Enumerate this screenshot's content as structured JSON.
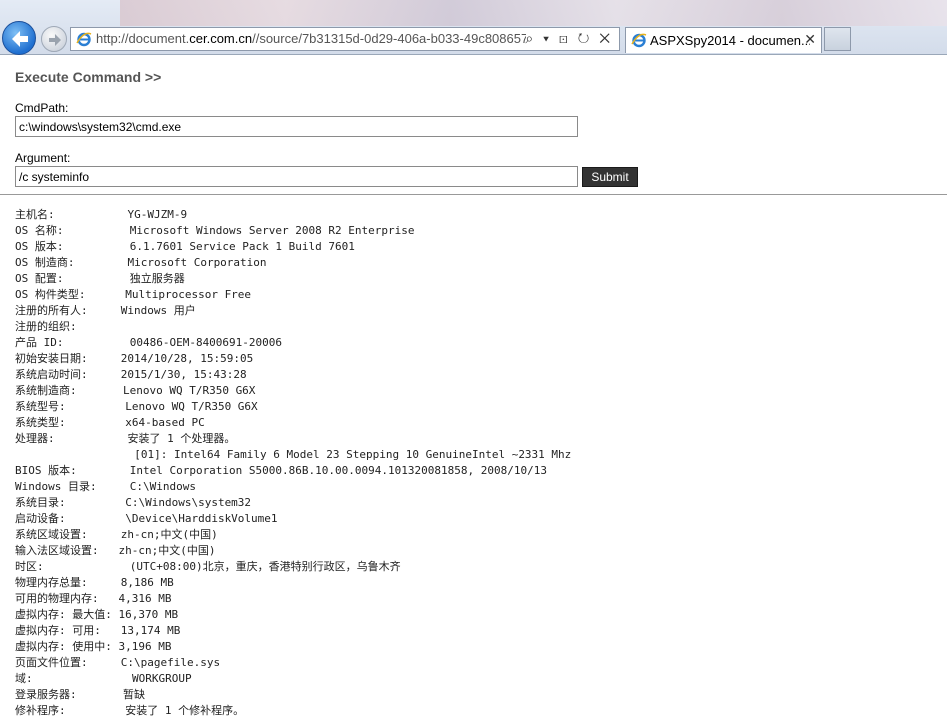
{
  "browser": {
    "url_prefix": "http://document.",
    "url_domain": "cer.com.cn",
    "url_suffix": "//source/7b31315d-0d29-406a-b033-49c808657",
    "tab_title": "ASPXSpy2014 - documen...",
    "address_tools": "⌕ ▾ ⊡ ↻ ✕",
    "tab_close": "✕"
  },
  "page": {
    "heading": "Execute Command >>",
    "cmdpath_label": "CmdPath:",
    "cmdpath_value": "c:\\windows\\system32\\cmd.exe",
    "argument_label": "Argument:",
    "argument_value": "/c systeminfo",
    "submit_label": "Submit"
  },
  "output": {
    "text": "主机名:           YG-WJZM-9\nOS 名称:          Microsoft Windows Server 2008 R2 Enterprise\nOS 版本:          6.1.7601 Service Pack 1 Build 7601\nOS 制造商:        Microsoft Corporation\nOS 配置:          独立服务器\nOS 构件类型:      Multiprocessor Free\n注册的所有人:     Windows 用户\n注册的组织:\n产品 ID:          00486-OEM-8400691-20006\n初始安装日期:     2014/10/28, 15:59:05\n系统启动时间:     2015/1/30, 15:43:28\n系统制造商:       Lenovo WQ T/R350 G6X\n系统型号:         Lenovo WQ T/R350 G6X\n系统类型:         x64-based PC\n处理器:           安装了 1 个处理器。\n                  [01]: Intel64 Family 6 Model 23 Stepping 10 GenuineIntel ~2331 Mhz\nBIOS 版本:        Intel Corporation S5000.86B.10.00.0094.101320081858, 2008/10/13\nWindows 目录:     C:\\Windows\n系统目录:         C:\\Windows\\system32\n启动设备:         \\Device\\HarddiskVolume1\n系统区域设置:     zh-cn;中文(中国)\n输入法区域设置:   zh-cn;中文(中国)\n时区:             (UTC+08:00)北京，重庆，香港特别行政区，乌鲁木齐\n物理内存总量:     8,186 MB\n可用的物理内存:   4,316 MB\n虚拟内存: 最大值: 16,370 MB\n虚拟内存: 可用:   13,174 MB\n虚拟内存: 使用中: 3,196 MB\n页面文件位置:     C:\\pagefile.sys\n域:               WORKGROUP\n登录服务器:       暂缺\n修补程序:         安装了 1 个修补程序。"
  },
  "icons": {
    "back": "back-arrow-icon",
    "forward": "forward-arrow-icon",
    "site": "ie-logo-icon"
  }
}
